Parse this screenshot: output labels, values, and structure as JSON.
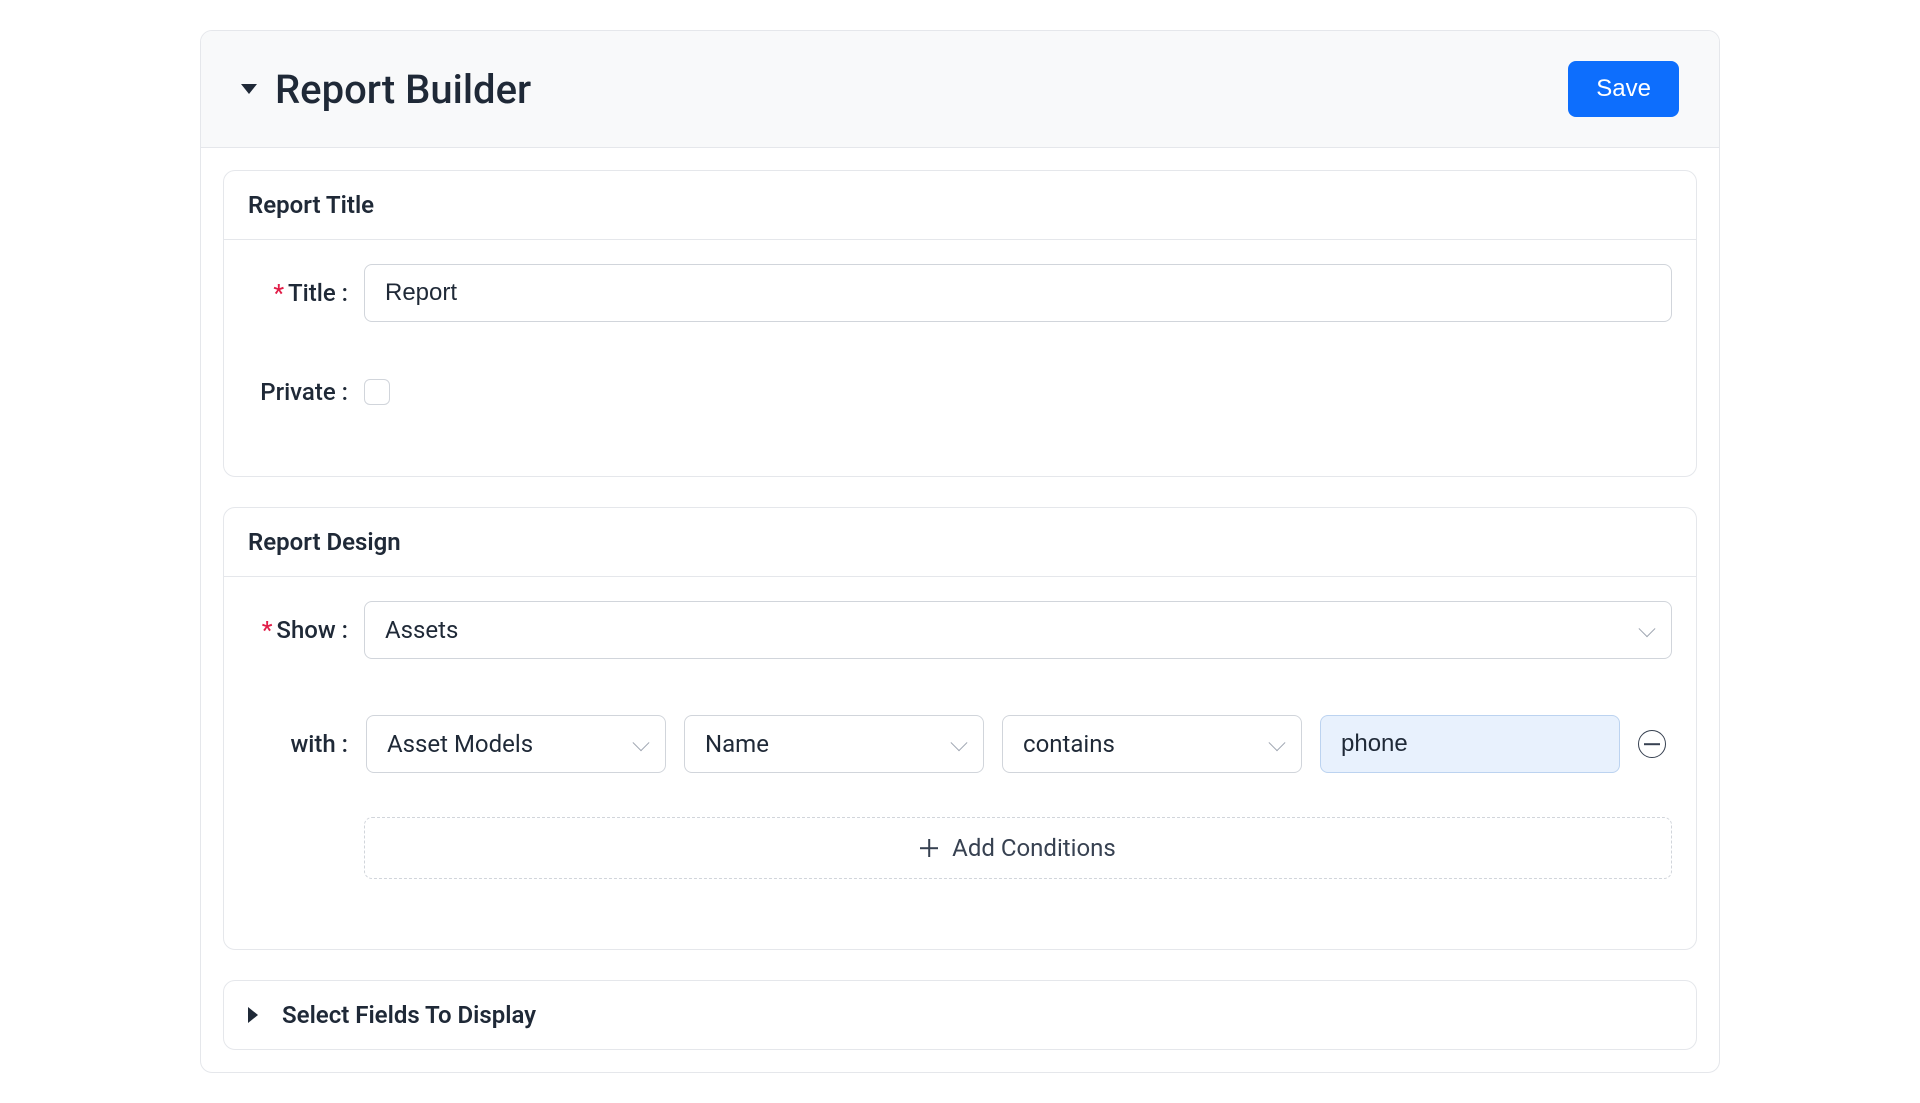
{
  "header": {
    "title": "Report Builder",
    "save_label": "Save"
  },
  "sections": {
    "report_title": {
      "heading": "Report Title",
      "title_label": "Title :",
      "title_value": "Report",
      "private_label": "Private :"
    },
    "report_design": {
      "heading": "Report Design",
      "show_label": "Show :",
      "show_value": "Assets",
      "with_label": "with :",
      "condition": {
        "category": "Asset Models",
        "field": "Name",
        "operator": "contains",
        "value": "phone"
      },
      "add_conditions_label": "Add Conditions"
    },
    "fields": {
      "heading": "Select Fields To Display"
    }
  }
}
